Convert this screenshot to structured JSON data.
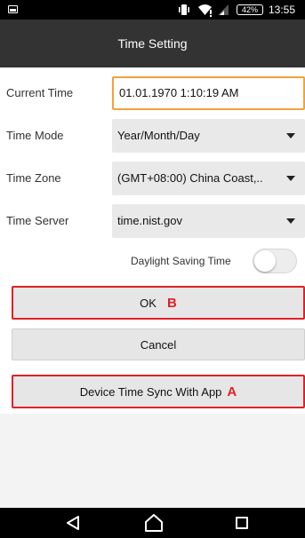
{
  "status_bar": {
    "battery": "42%",
    "time": "13:55"
  },
  "app_bar": {
    "title": "Time Setting"
  },
  "form": {
    "current_time": {
      "label": "Current Time",
      "value": "01.01.1970 1:10:19 AM"
    },
    "time_mode": {
      "label": "Time Mode",
      "value": "Year/Month/Day"
    },
    "time_zone": {
      "label": "Time Zone",
      "value": "(GMT+08:00) China Coast,.."
    },
    "time_server": {
      "label": "Time Server",
      "value": "time.nist.gov"
    },
    "daylight_saving": {
      "label": "Daylight Saving Time",
      "enabled": false
    }
  },
  "buttons": {
    "ok": {
      "label": "OK",
      "marker": "B"
    },
    "cancel": {
      "label": "Cancel"
    },
    "sync": {
      "label": "Device Time Sync With App",
      "marker": "A"
    }
  },
  "colors": {
    "accent_orange": "#f4a13a",
    "annotation_red": "#e0202a",
    "app_bar": "#333333"
  },
  "icons": {
    "status": [
      "notification-icon",
      "vibrate-icon",
      "wifi-icon",
      "signal-icon",
      "battery-icon"
    ],
    "nav": [
      "back-icon",
      "home-icon",
      "recent-apps-icon"
    ]
  }
}
